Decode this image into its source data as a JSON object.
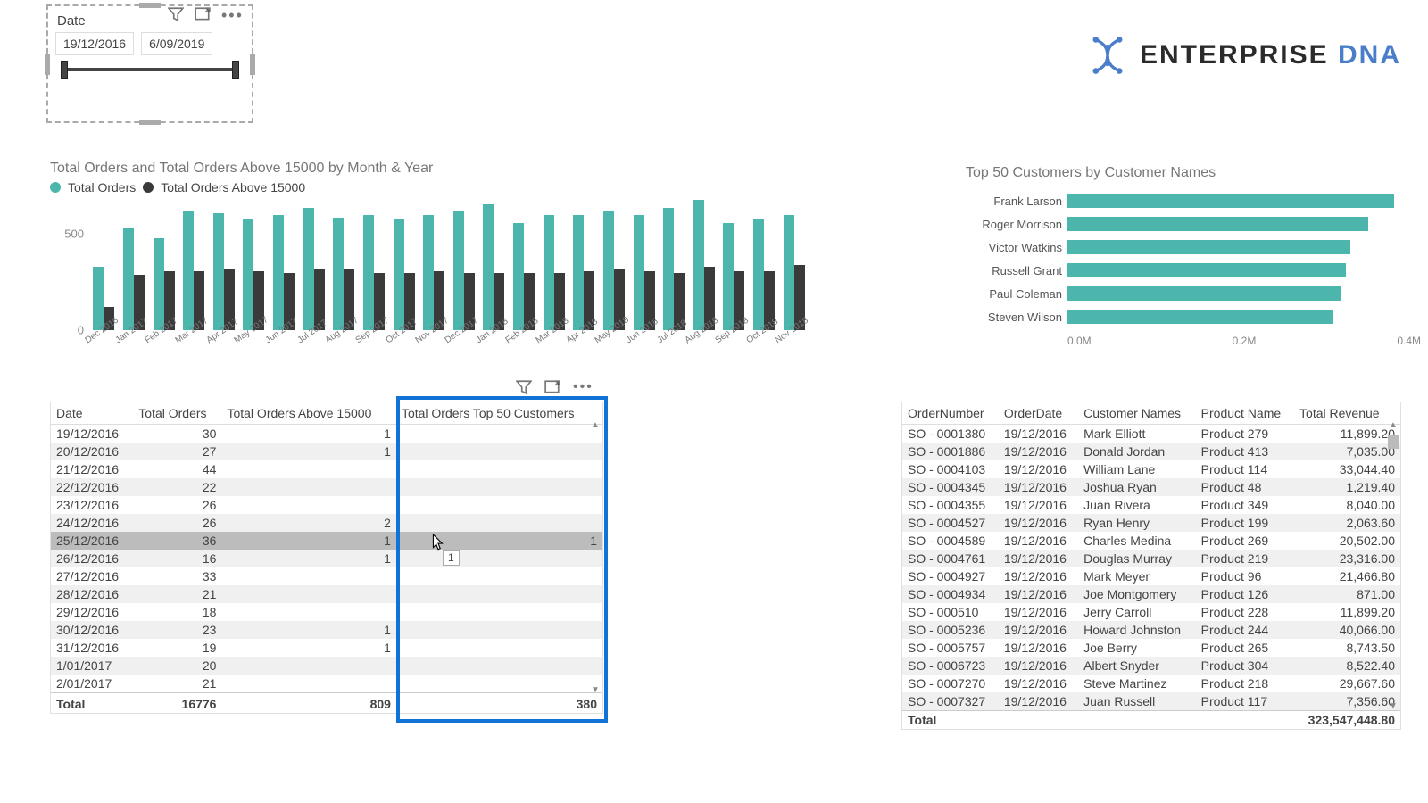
{
  "brand": {
    "name": "ENTERPRISE",
    "suffix": "DNA"
  },
  "slicer": {
    "title": "Date",
    "from": "19/12/2016",
    "to": "6/09/2019"
  },
  "toolbar_icons": [
    "filter-icon",
    "focus-icon",
    "more-icon"
  ],
  "chart1": {
    "title": "Total Orders and Total Orders Above 15000 by Month & Year",
    "legend": [
      "Total Orders",
      "Total Orders Above 15000"
    ],
    "yticks": [
      "500",
      "0"
    ]
  },
  "chart_data": [
    {
      "type": "bar",
      "title": "Total Orders and Total Orders Above 15000 by Month & Year",
      "xlabel": "Month & Year",
      "ylabel": "",
      "ylim": [
        0,
        700
      ],
      "categories": [
        "Dec 2016",
        "Jan 2017",
        "Feb 2017",
        "Mar 2017",
        "Apr 2017",
        "May 2017",
        "Jun 2017",
        "Jul 2017",
        "Aug 2017",
        "Sep 2017",
        "Oct 2017",
        "Nov 2017",
        "Dec 2017",
        "Jan 2018",
        "Feb 2018",
        "Mar 2018",
        "Apr 2018",
        "May 2018",
        "Jun 2018",
        "Jul 2018",
        "Aug 2018",
        "Sep 2018",
        "Oct 2018",
        "Nov 2018"
      ],
      "series": [
        {
          "name": "Total Orders",
          "values": [
            330,
            530,
            480,
            620,
            610,
            580,
            600,
            640,
            590,
            600,
            580,
            600,
            620,
            660,
            560,
            600,
            600,
            620,
            600,
            640,
            680,
            560,
            580,
            600
          ]
        },
        {
          "name": "Total Orders Above 15000",
          "values": [
            120,
            290,
            310,
            310,
            320,
            310,
            300,
            320,
            320,
            300,
            300,
            310,
            300,
            300,
            300,
            300,
            310,
            320,
            310,
            300,
            330,
            310,
            310,
            340
          ]
        }
      ]
    },
    {
      "type": "bar",
      "orientation": "horizontal",
      "title": "Top 50 Customers by Customer Names",
      "xlabel": "",
      "ylabel": "",
      "xlim": [
        0,
        400000
      ],
      "xticks": [
        "0.0M",
        "0.2M",
        "0.4M"
      ],
      "categories": [
        "Frank Larson",
        "Roger Morrison",
        "Victor Watkins",
        "Russell Grant",
        "Paul Coleman",
        "Steven Wilson"
      ],
      "values": [
        370000,
        340000,
        320000,
        315000,
        310000,
        300000
      ]
    }
  ],
  "chart2": {
    "title": "Top 50 Customers by Customer Names"
  },
  "table1": {
    "headers": [
      "Date",
      "Total Orders",
      "Total Orders Above 15000",
      "Total Orders Top 50 Customers"
    ],
    "rows": [
      [
        "19/12/2016",
        "30",
        "1",
        ""
      ],
      [
        "20/12/2016",
        "27",
        "1",
        ""
      ],
      [
        "21/12/2016",
        "44",
        "",
        ""
      ],
      [
        "22/12/2016",
        "22",
        "",
        ""
      ],
      [
        "23/12/2016",
        "26",
        "",
        ""
      ],
      [
        "24/12/2016",
        "26",
        "2",
        ""
      ],
      [
        "25/12/2016",
        "36",
        "1",
        "1"
      ],
      [
        "26/12/2016",
        "16",
        "1",
        ""
      ],
      [
        "27/12/2016",
        "33",
        "",
        ""
      ],
      [
        "28/12/2016",
        "21",
        "",
        ""
      ],
      [
        "29/12/2016",
        "18",
        "",
        ""
      ],
      [
        "30/12/2016",
        "23",
        "1",
        ""
      ],
      [
        "31/12/2016",
        "19",
        "1",
        ""
      ],
      [
        "1/01/2017",
        "20",
        "",
        ""
      ],
      [
        "2/01/2017",
        "21",
        "",
        ""
      ]
    ],
    "footer": [
      "Total",
      "16776",
      "809",
      "380"
    ],
    "highlight_col": 3,
    "selected_row": 6,
    "tooltip": "1"
  },
  "table2": {
    "headers": [
      "OrderNumber",
      "OrderDate",
      "Customer Names",
      "Product Name",
      "Total Revenue"
    ],
    "rows": [
      [
        "SO - 0001380",
        "19/12/2016",
        "Mark Elliott",
        "Product 279",
        "11,899.20"
      ],
      [
        "SO - 0001886",
        "19/12/2016",
        "Donald Jordan",
        "Product 413",
        "7,035.00"
      ],
      [
        "SO - 0004103",
        "19/12/2016",
        "William Lane",
        "Product 114",
        "33,044.40"
      ],
      [
        "SO - 0004345",
        "19/12/2016",
        "Joshua Ryan",
        "Product 48",
        "1,219.40"
      ],
      [
        "SO - 0004355",
        "19/12/2016",
        "Juan Rivera",
        "Product 349",
        "8,040.00"
      ],
      [
        "SO - 0004527",
        "19/12/2016",
        "Ryan Henry",
        "Product 199",
        "2,063.60"
      ],
      [
        "SO - 0004589",
        "19/12/2016",
        "Charles Medina",
        "Product 269",
        "20,502.00"
      ],
      [
        "SO - 0004761",
        "19/12/2016",
        "Douglas Murray",
        "Product 219",
        "23,316.00"
      ],
      [
        "SO - 0004927",
        "19/12/2016",
        "Mark Meyer",
        "Product 96",
        "21,466.80"
      ],
      [
        "SO - 0004934",
        "19/12/2016",
        "Joe Montgomery",
        "Product 126",
        "871.00"
      ],
      [
        "SO - 000510",
        "19/12/2016",
        "Jerry Carroll",
        "Product 228",
        "11,899.20"
      ],
      [
        "SO - 0005236",
        "19/12/2016",
        "Howard Johnston",
        "Product 244",
        "40,066.00"
      ],
      [
        "SO - 0005757",
        "19/12/2016",
        "Joe Berry",
        "Product 265",
        "8,743.50"
      ],
      [
        "SO - 0006723",
        "19/12/2016",
        "Albert Snyder",
        "Product 304",
        "8,522.40"
      ],
      [
        "SO - 0007270",
        "19/12/2016",
        "Steve Martinez",
        "Product 218",
        "29,667.60"
      ],
      [
        "SO - 0007327",
        "19/12/2016",
        "Juan Russell",
        "Product 117",
        "7,356.60"
      ]
    ],
    "footer": [
      "Total",
      "",
      "",
      "",
      "323,547,448.80"
    ]
  }
}
